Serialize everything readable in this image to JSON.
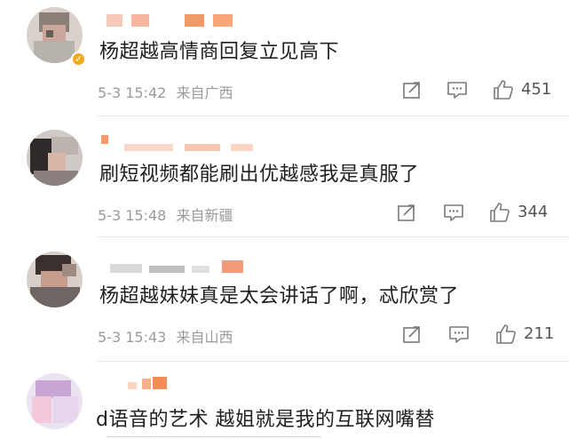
{
  "comments": [
    {
      "text": "杨超越高情商回复立见高下",
      "date": "5-3",
      "time": "15:42",
      "source": "来自广西",
      "likes": "451",
      "verified": true
    },
    {
      "text": "刷短视频都能刷出优越感我是真服了",
      "date": "5-3",
      "time": "15:48",
      "source": "来自新疆",
      "likes": "344",
      "verified": false
    },
    {
      "text": "杨超越妹妹真是太会讲话了啊，忒欣赏了",
      "date": "5-3",
      "time": "15:43",
      "source": "来自山西",
      "likes": "211",
      "verified": false
    },
    {
      "text": "d语音的艺术 越姐就是我的互联网嘴替",
      "verified": false
    }
  ],
  "icons": {
    "repost": "share-icon",
    "comment": "comment-icon",
    "like": "thumbs-up-icon",
    "verified": "verified-badge-icon"
  },
  "colors": {
    "text": "#202020",
    "meta": "#9a9a9a",
    "icon": "#7a7a7a",
    "verified": "#f3a91d",
    "divider": "#e8e8e8"
  }
}
